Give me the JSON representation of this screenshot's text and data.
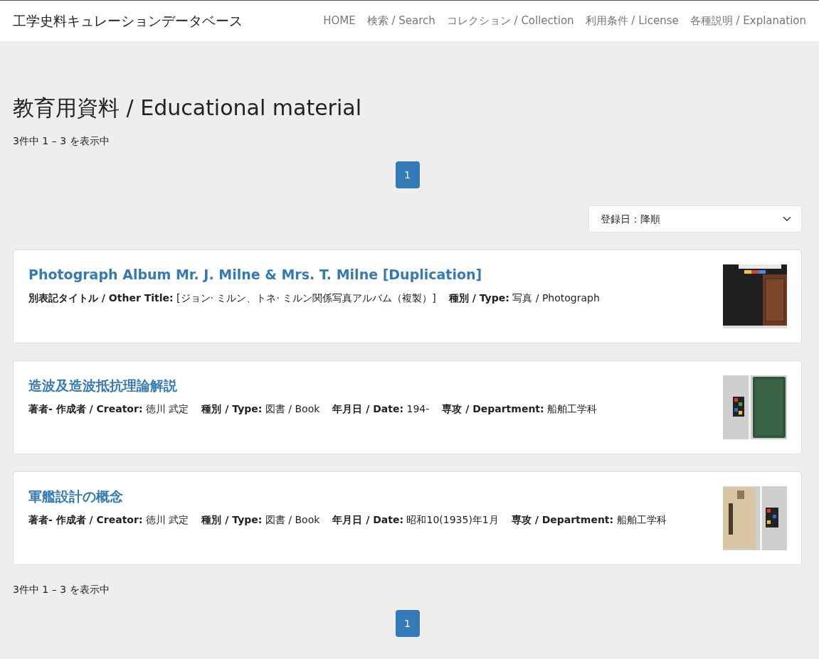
{
  "navbar": {
    "brand": "工学史料キュレーションデータベース",
    "links": [
      {
        "label": "HOME"
      },
      {
        "label": "検索 / Search"
      },
      {
        "label": "コレクション / Collection"
      },
      {
        "label": "利用条件 / License"
      },
      {
        "label": "各種説明 / Explanation"
      }
    ]
  },
  "heading": "教育用資料 / Educational material",
  "summary_top": "3件中 1 – 3 を表示中",
  "pagination_top": [
    {
      "label": "1",
      "selected": true
    }
  ],
  "sort": {
    "value": "登録日：降順"
  },
  "items": [
    {
      "title": "Photograph Album Mr. J. Milne & Mrs. T. Milne [Duplication]",
      "fields": [
        {
          "label": "別表記タイトル / Other Title:",
          "value": "[ジョン· ミルン、トネ· ミルン関係写真アルバム（複製）]"
        },
        {
          "label": "種別 / Type:",
          "value": "写真 / Photograph"
        }
      ],
      "thumbnail": {
        "kind": "picture"
      }
    },
    {
      "title": "造波及造波抵抗理論解説",
      "fields": [
        {
          "label": "著者‐ 作成者 / Creator:",
          "value": "徳川 武定"
        },
        {
          "label": "種別 / Type:",
          "value": "図書 / Book"
        },
        {
          "label": "年月日 / Date:",
          "value": "194-"
        },
        {
          "label": "専攻 / Department:",
          "value": "船舶工学科"
        }
      ],
      "thumbnail": {
        "kind": "picture"
      }
    },
    {
      "title": "軍艦設計の概念",
      "fields": [
        {
          "label": "著者‐ 作成者 / Creator:",
          "value": "徳川 武定"
        },
        {
          "label": "種別 / Type:",
          "value": "図書 / Book"
        },
        {
          "label": "年月日 / Date:",
          "value": "昭和10(1935)年1月"
        },
        {
          "label": "専攻 / Department:",
          "value": "船舶工学科"
        }
      ],
      "thumbnail": {
        "kind": "picture"
      }
    }
  ],
  "summary_bottom": "3件中 1 – 3 を表示中",
  "pagination_bottom": [
    {
      "label": "1",
      "selected": true
    }
  ]
}
